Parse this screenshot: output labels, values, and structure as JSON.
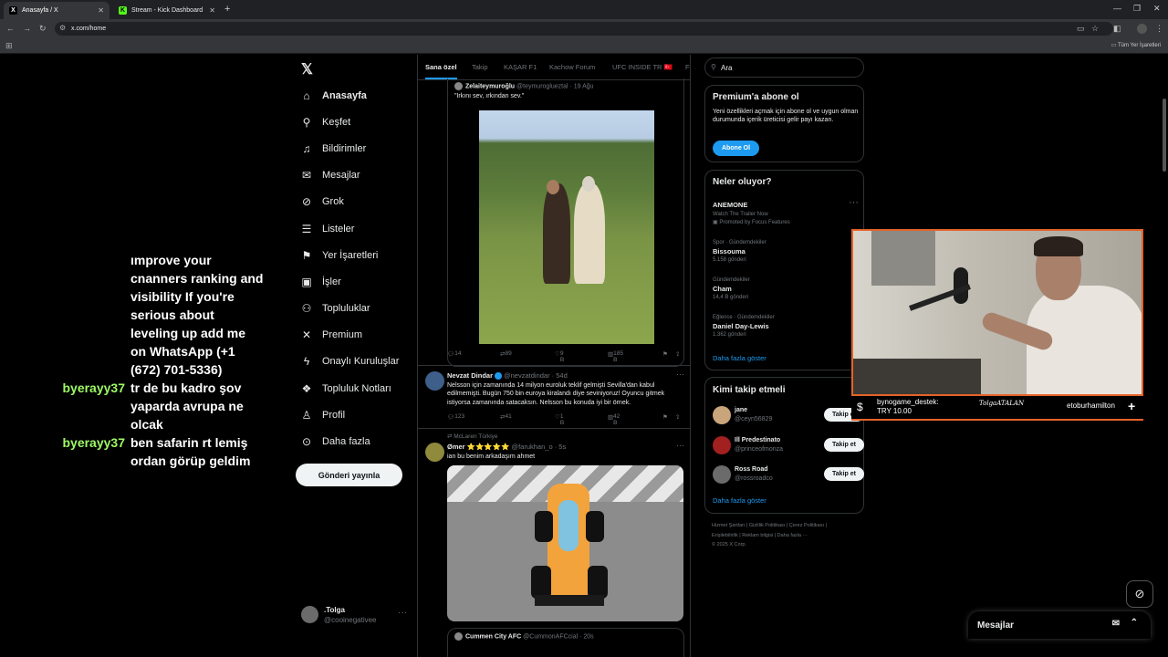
{
  "browser": {
    "tabs": [
      {
        "title": "Anasayfa / X",
        "icon": "x-logo-icon",
        "active": true
      },
      {
        "title": "Stream - Kick Dashboard",
        "icon": "kick-logo-icon",
        "active": false
      }
    ],
    "url": "x.com/home",
    "all_bookmarks": "Tüm Yer İşaretleri"
  },
  "stream_chat": [
    {
      "user": "",
      "message": "ımprove your cnanners ranking and visibility If you're serious about leveling up add me on WhatsApp (+1 (672) 701-5336)"
    },
    {
      "user": "byerayy37",
      "message": "tr de bu kadro şov yaparda avrupa ne olcak"
    },
    {
      "user": "byerayy37",
      "message": "ben safarin rt lemiş ordan görüp geldim"
    }
  ],
  "nav": {
    "items": [
      {
        "label": "Anasayfa",
        "icon": "home-icon",
        "glyph": "⌂"
      },
      {
        "label": "Keşfet",
        "icon": "search-icon",
        "glyph": "⚲"
      },
      {
        "label": "Bildirimler",
        "icon": "bell-icon",
        "glyph": "♫"
      },
      {
        "label": "Mesajlar",
        "icon": "envelope-icon",
        "glyph": "✉"
      },
      {
        "label": "Grok",
        "icon": "grok-icon",
        "glyph": "⊘"
      },
      {
        "label": "Listeler",
        "icon": "list-icon",
        "glyph": "☰"
      },
      {
        "label": "Yer İşaretleri",
        "icon": "bookmark-icon",
        "glyph": "⚑"
      },
      {
        "label": "İşler",
        "icon": "briefcase-icon",
        "glyph": "▣"
      },
      {
        "label": "Topluluklar",
        "icon": "communities-icon",
        "glyph": "⚇"
      },
      {
        "label": "Premium",
        "icon": "x-premium-icon",
        "glyph": "✕"
      },
      {
        "label": "Onaylı Kuruluşlar",
        "icon": "lightning-icon",
        "glyph": "ϟ"
      },
      {
        "label": "Topluluk Notları",
        "icon": "notes-icon",
        "glyph": "❖"
      },
      {
        "label": "Profil",
        "icon": "profile-icon",
        "glyph": "♙"
      },
      {
        "label": "Daha fazla",
        "icon": "more-circle-icon",
        "glyph": "⊙"
      }
    ],
    "post_button": "Gönderi yayınla",
    "account_name": ".Tolga",
    "account_handle": "@cooinegativee"
  },
  "feed": {
    "tabs": [
      "Sana özel",
      "Takip",
      "KAŞAR F1",
      "Kachow Forum",
      "UFC INSIDE TR 🇹🇷",
      "Fo"
    ],
    "quote1": {
      "name": "Zelaiteymuroğlu",
      "meta": "@teymuroglueztal · 19 Ağu",
      "text": "\"Irkını sev, ırkından sev.\""
    },
    "actions1": {
      "replies": "14",
      "reposts": "89",
      "likes": "9 B",
      "views": "185 B"
    },
    "tweet2": {
      "name": "Nevzat Dindar",
      "meta": "@nevzatdindar · 54d",
      "text": "Nelsson için zamanında 14 milyon euroluk teklif gelmişti Sevilla'dan kabul edilmemişti. Bugün 750 bin euroya kiralandı diye seviniyoruz! Oyuncu gitmek istiyorsa zamanında satacaksın. Nelsson bu konuda iyi bir örnek."
    },
    "actions2": {
      "replies": "123",
      "reposts": "41",
      "likes": "1 B",
      "views": "42 B"
    },
    "tweet3": {
      "context": "McLaren Türkiye",
      "name": "Ømer ⭐⭐⭐⭐⭐",
      "meta": "@farukhan_o · 5s",
      "text": "ian bu benim arkadaşım ahmet"
    },
    "quote2": {
      "name": "Cummen City AFC",
      "meta": "@CummonAFCcial · 20s"
    }
  },
  "right": {
    "search_placeholder": "Ara",
    "premium": {
      "title": "Premium'a abone ol",
      "text": "Yeni özellikleri açmak için abone ol ve uygun olman durumunda içerik üreticisi gelir payı kazan.",
      "button": "Abone Ol"
    },
    "trends": {
      "title": "Neler oluyor?",
      "items": [
        {
          "category": "",
          "title": "ANEMONE",
          "count": "Watch The Trailer Now",
          "extra": "Promoted by Focus Features"
        },
        {
          "category": "Spor · Gündemdekiler",
          "title": "Bissouma",
          "count": "5.158 gönderi"
        },
        {
          "category": "Gündemdekiler",
          "title": "Cham",
          "count": "14,4 B gönderi"
        },
        {
          "category": "Eğlence · Gündemdekiler",
          "title": "Daniel Day-Lewis",
          "count": "1.362 gönderi"
        }
      ],
      "show_more": "Daha fazla göster"
    },
    "who_to_follow": {
      "title": "Kimi takip etmeli",
      "items": [
        {
          "name": "jane",
          "handle": "@ceyn56829",
          "button": "Takip et",
          "color": "#c8a57a"
        },
        {
          "name": "Ill Predestinato",
          "handle": "@princeofmonza",
          "button": "Takip et",
          "color": "#a32020"
        },
        {
          "name": "Ross Road",
          "handle": "@rossroadco",
          "button": "Takip et",
          "color": "#6b6b6b"
        }
      ],
      "show_more": "Daha fazla göster"
    },
    "footer": [
      "Hizmet Şartları",
      "Gizlilik Politikası",
      "Çerez Politikası",
      "Erişilebilirlik",
      "Reklam bilgisi",
      "Daha fazla ···",
      "© 2025 X Corp."
    ]
  },
  "stream_overlay": {
    "donor": "bynogame_destek:",
    "amount": "TRY 10.00",
    "signature": "TolgaATALAN",
    "handle": "etoburhamilton"
  },
  "messages_bar": {
    "label": "Mesajlar"
  },
  "colors": {
    "accent": "#1d9bf0",
    "chat_user": "#9dfa66",
    "cam_border": "#e4632a"
  }
}
